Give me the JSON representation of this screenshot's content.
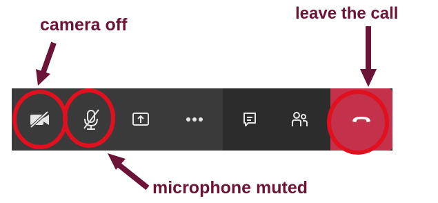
{
  "annotations": {
    "camera": "camera off",
    "leave": "leave the call",
    "microphone": "microphone muted"
  },
  "toolbar": {
    "buttons": [
      {
        "icon": "camera-off-icon"
      },
      {
        "icon": "mic-muted-icon"
      },
      {
        "icon": "share-screen-icon"
      },
      {
        "icon": "more-options-icon"
      },
      {
        "icon": "chat-icon"
      },
      {
        "icon": "participants-icon"
      },
      {
        "icon": "hang-up-icon"
      }
    ]
  },
  "colors": {
    "annotation": "#6b1438",
    "highlight_circle": "#e0101f",
    "leave_button": "#c4314b",
    "toolbar_bg": "#2c2c2c"
  }
}
